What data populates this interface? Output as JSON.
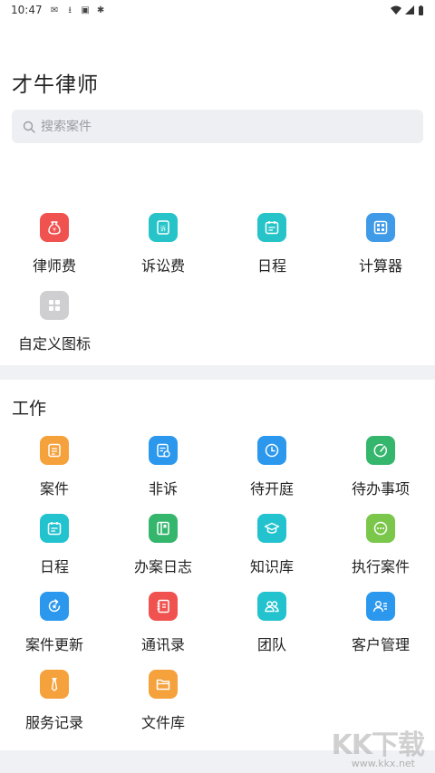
{
  "status_bar": {
    "time": "10:47"
  },
  "app": {
    "title": "才牛律师"
  },
  "search": {
    "placeholder": "搜索案件"
  },
  "quick_tools": [
    {
      "label": "律师费",
      "icon": "money-bag-icon",
      "color": "#f0524f"
    },
    {
      "label": "诉讼费",
      "icon": "lawsuit-doc-icon",
      "color": "#26c4c9"
    },
    {
      "label": "日程",
      "icon": "calendar-icon",
      "color": "#26c4c9"
    },
    {
      "label": "计算器",
      "icon": "calculator-icon",
      "color": "#3f9ae8"
    },
    {
      "label": "自定义图标",
      "icon": "custom-grid-icon",
      "color": "#cfcfd2"
    }
  ],
  "work": {
    "title": "工作",
    "items": [
      {
        "label": "案件",
        "icon": "case-icon",
        "color": "#f5a13c"
      },
      {
        "label": "非诉",
        "icon": "non-litigation-icon",
        "color": "#2b98ee"
      },
      {
        "label": "待开庭",
        "icon": "clock-icon",
        "color": "#2b98ee"
      },
      {
        "label": "待办事项",
        "icon": "todo-icon",
        "color": "#35b66d"
      },
      {
        "label": "日程",
        "icon": "calendar-icon",
        "color": "#22c3cf"
      },
      {
        "label": "办案日志",
        "icon": "journal-icon",
        "color": "#35b66d"
      },
      {
        "label": "知识库",
        "icon": "knowledge-icon",
        "color": "#22c3cf"
      },
      {
        "label": "执行案件",
        "icon": "execution-icon",
        "color": "#7bc74b"
      },
      {
        "label": "案件更新",
        "icon": "update-icon",
        "color": "#2b98ee"
      },
      {
        "label": "通讯录",
        "icon": "contacts-icon",
        "color": "#f0524f"
      },
      {
        "label": "团队",
        "icon": "team-icon",
        "color": "#22c3cf"
      },
      {
        "label": "客户管理",
        "icon": "client-icon",
        "color": "#2b98ee"
      },
      {
        "label": "服务记录",
        "icon": "service-record-icon",
        "color": "#f5a13c"
      },
      {
        "label": "文件库",
        "icon": "file-library-icon",
        "color": "#f5a13c"
      }
    ]
  },
  "watermark": {
    "big": "KK下载",
    "small": "www.kkx.net"
  }
}
